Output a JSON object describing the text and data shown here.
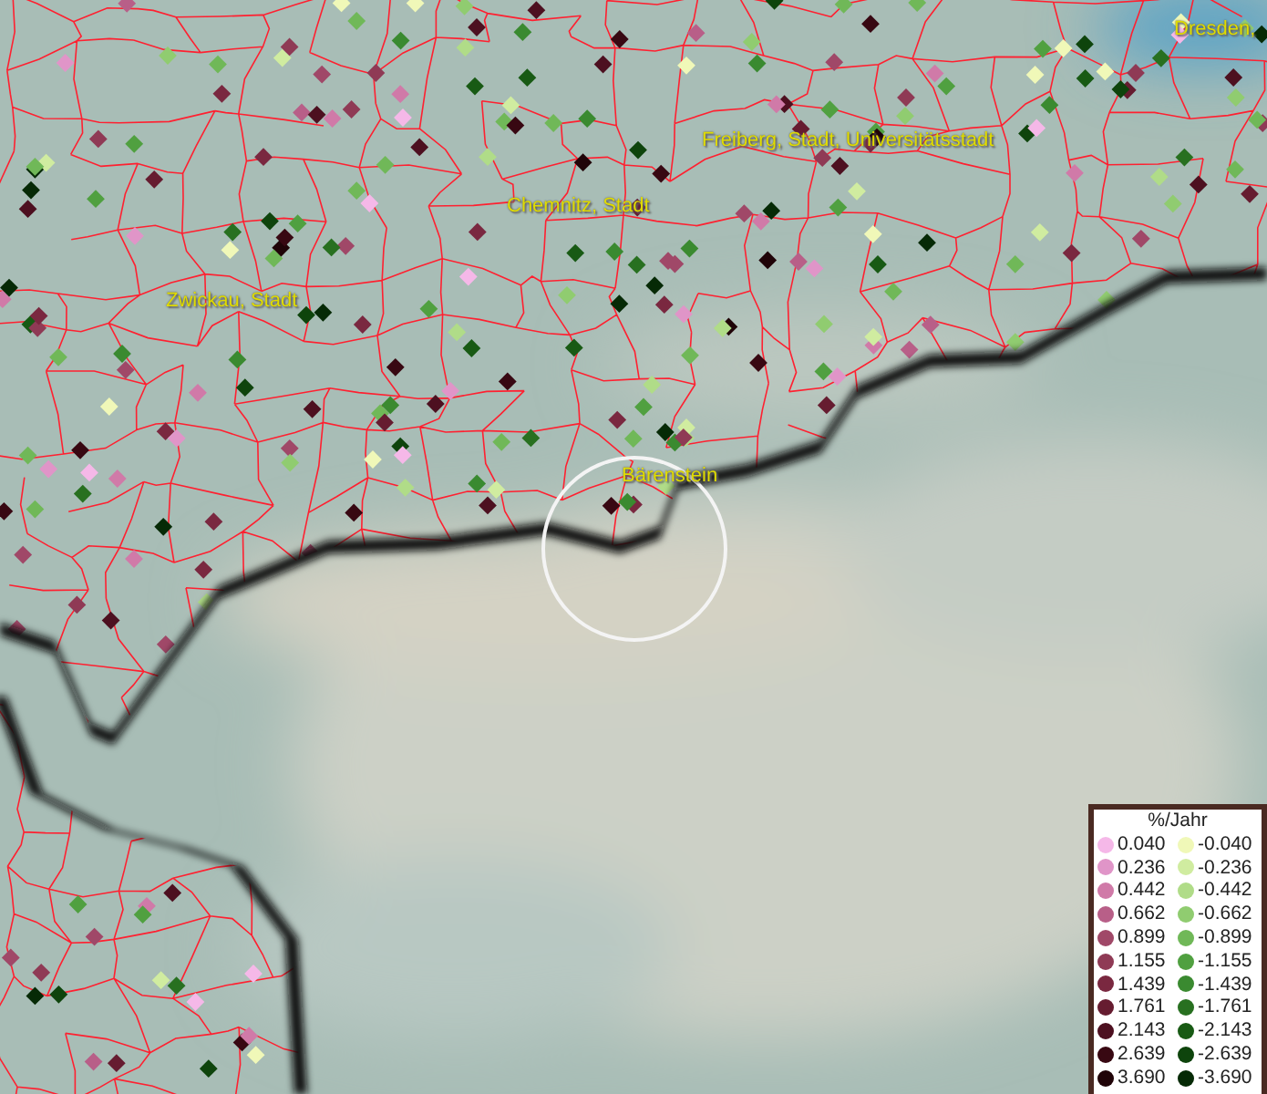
{
  "map": {
    "place_labels": [
      {
        "text": "Dresden,"
      },
      {
        "text": "Freiberg, Stadt, Universitätsstadt"
      },
      {
        "text": "Chemnitz, Stadt"
      },
      {
        "text": "Zwickau, Stadt"
      },
      {
        "text": "Bärenstein"
      }
    ]
  },
  "legend": {
    "title": "%/Jahr",
    "positive": [
      {
        "label": "0.040",
        "color": "#f5b8e8"
      },
      {
        "label": "0.236",
        "color": "#e095c8"
      },
      {
        "label": "0.442",
        "color": "#d07aa8"
      },
      {
        "label": "0.662",
        "color": "#b85f88"
      },
      {
        "label": "0.899",
        "color": "#a04868"
      },
      {
        "label": "1.155",
        "color": "#8f3a55"
      },
      {
        "label": "1.439",
        "color": "#7a2840"
      },
      {
        "label": "1.761",
        "color": "#661c30"
      },
      {
        "label": "2.143",
        "color": "#4d1020"
      },
      {
        "label": "2.639",
        "color": "#380812"
      },
      {
        "label": "3.690",
        "color": "#200408"
      }
    ],
    "negative": [
      {
        "label": "-0.040",
        "color": "#f0f8b8"
      },
      {
        "label": "-0.236",
        "color": "#d0eca0"
      },
      {
        "label": "-0.442",
        "color": "#b0dc88"
      },
      {
        "label": "-0.662",
        "color": "#90cc70"
      },
      {
        "label": "-0.899",
        "color": "#70b858"
      },
      {
        "label": "-1.155",
        "color": "#50a040"
      },
      {
        "label": "-1.439",
        "color": "#3a8a30"
      },
      {
        "label": "-1.761",
        "color": "#287020"
      },
      {
        "label": "-2.143",
        "color": "#185a14"
      },
      {
        "label": "-2.639",
        "color": "#0e440c"
      },
      {
        "label": "-3.690",
        "color": "#062a06"
      }
    ]
  }
}
